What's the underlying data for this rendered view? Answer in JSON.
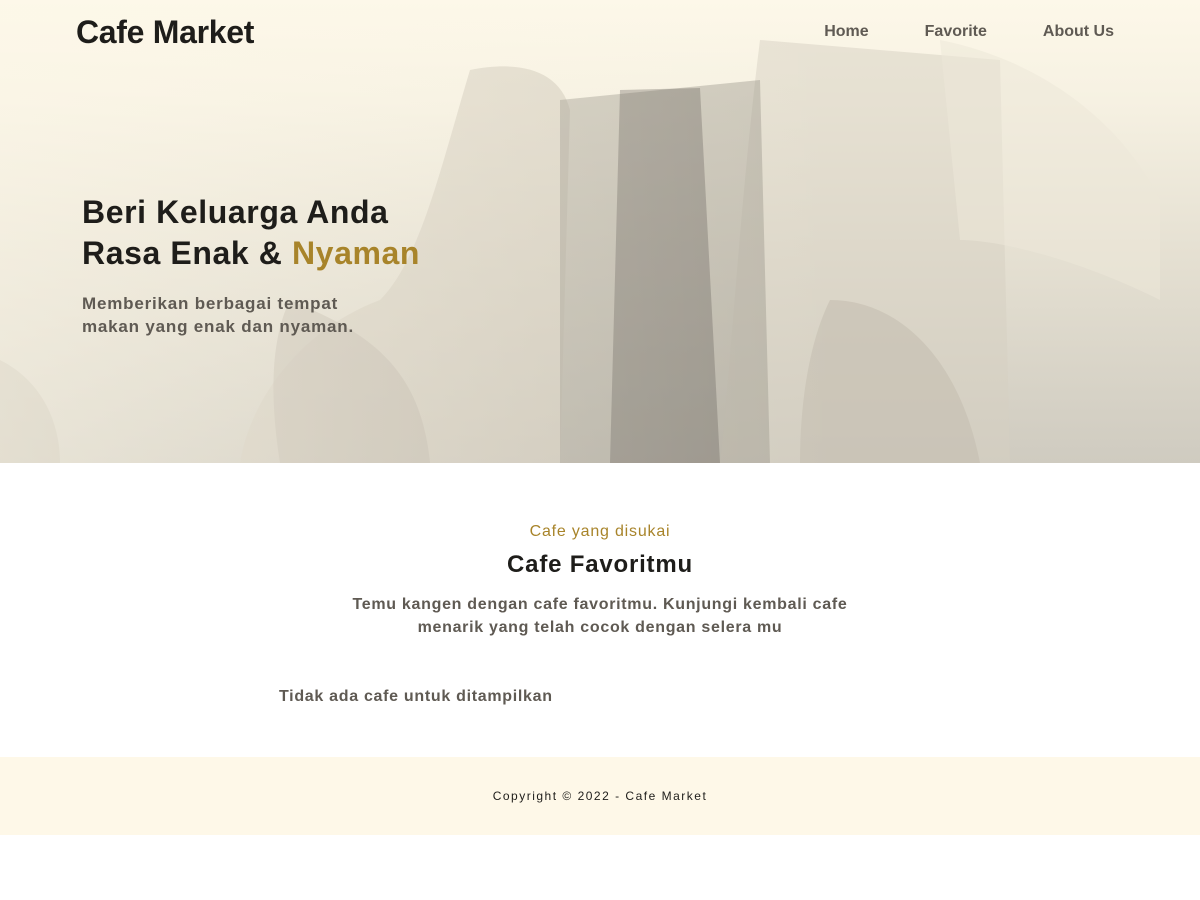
{
  "header": {
    "brand": "Cafe Market",
    "nav": [
      "Home",
      "Favorite",
      "About Us"
    ]
  },
  "hero": {
    "title_line1": "Beri Keluarga Anda",
    "title_line2_prefix": "Rasa Enak & ",
    "title_line2_accent": "Nyaman",
    "subtitle_line1": "Memberikan berbagai tempat",
    "subtitle_line2": "makan yang enak dan nyaman."
  },
  "favorites": {
    "eyebrow": "Cafe yang disukai",
    "title": "Cafe Favoritmu",
    "description": "Temu kangen dengan cafe favoritmu. Kunjungi kembali cafe menarik yang telah cocok dengan selera mu",
    "empty_message": "Tidak ada cafe untuk ditampilkan"
  },
  "footer": {
    "copyright": "Copyright © 2022 - Cafe Market"
  },
  "colors": {
    "accent": "#a8842a",
    "header_bg": "#fef8e8",
    "text_dark": "#1e1d1a",
    "text_muted": "#5f5a53"
  }
}
